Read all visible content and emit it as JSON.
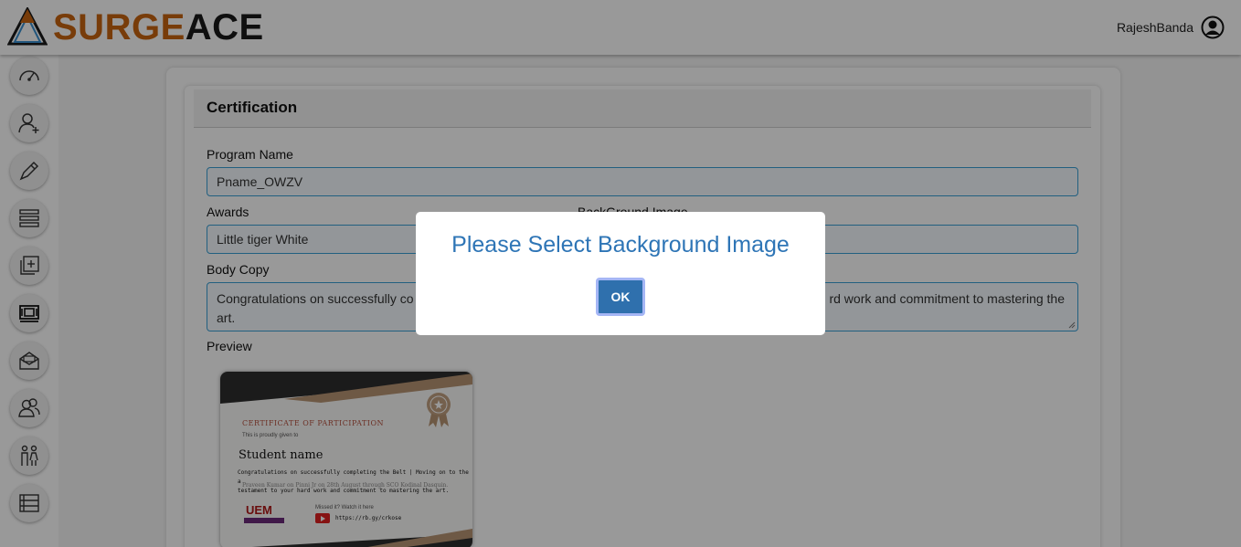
{
  "header": {
    "logo_surge": "SURGE",
    "logo_ace": "ACE",
    "username": "RajeshBanda"
  },
  "sidebar": {
    "items": [
      {
        "icon": "dashboard-icon"
      },
      {
        "icon": "add-user-icon"
      },
      {
        "icon": "pen-icon"
      },
      {
        "icon": "list-icon"
      },
      {
        "icon": "add-document-icon"
      },
      {
        "icon": "certificate-icon"
      },
      {
        "icon": "mail-icon"
      },
      {
        "icon": "users-icon"
      },
      {
        "icon": "family-icon"
      },
      {
        "icon": "table-icon"
      }
    ]
  },
  "form": {
    "title": "Certification",
    "program_name_label": "Program Name",
    "program_name_value": "Pname_OWZV",
    "awards_label": "Awards",
    "awards_value": "Little tiger White",
    "background_label": "BackGround Image",
    "body_copy_label": "Body Copy",
    "body_copy_value_left": "Congratulations on successfully co",
    "body_copy_value_right": "rd work and commitment to mastering the",
    "body_copy_value_line2": "art.",
    "preview_label": "Preview"
  },
  "certificate": {
    "title": "CERTIFICATE OF PARTICIPATION",
    "given_to": "This is proudly given to",
    "student": "Student name",
    "body_line1": "Congratulations on successfully completing the Belt | Moving on to the next belt is a",
    "body_line2": "testament to your hard work and commitment to mastering the art.",
    "overlap": "Praveen Kumar on Pinni Jr on 28th August through SCO Kodinal Dasquin.",
    "missed": "Missed it? Watch it here",
    "link": "https://rb.gy/crkose",
    "uem": "UEM"
  },
  "dialog": {
    "message": "Please Select Background Image",
    "ok_label": "OK"
  },
  "colors": {
    "accent_orange": "#c9650f",
    "dialog_blue": "#2e75b6",
    "button_blue": "#2f70ad",
    "field_border": "#3aa0d6"
  }
}
